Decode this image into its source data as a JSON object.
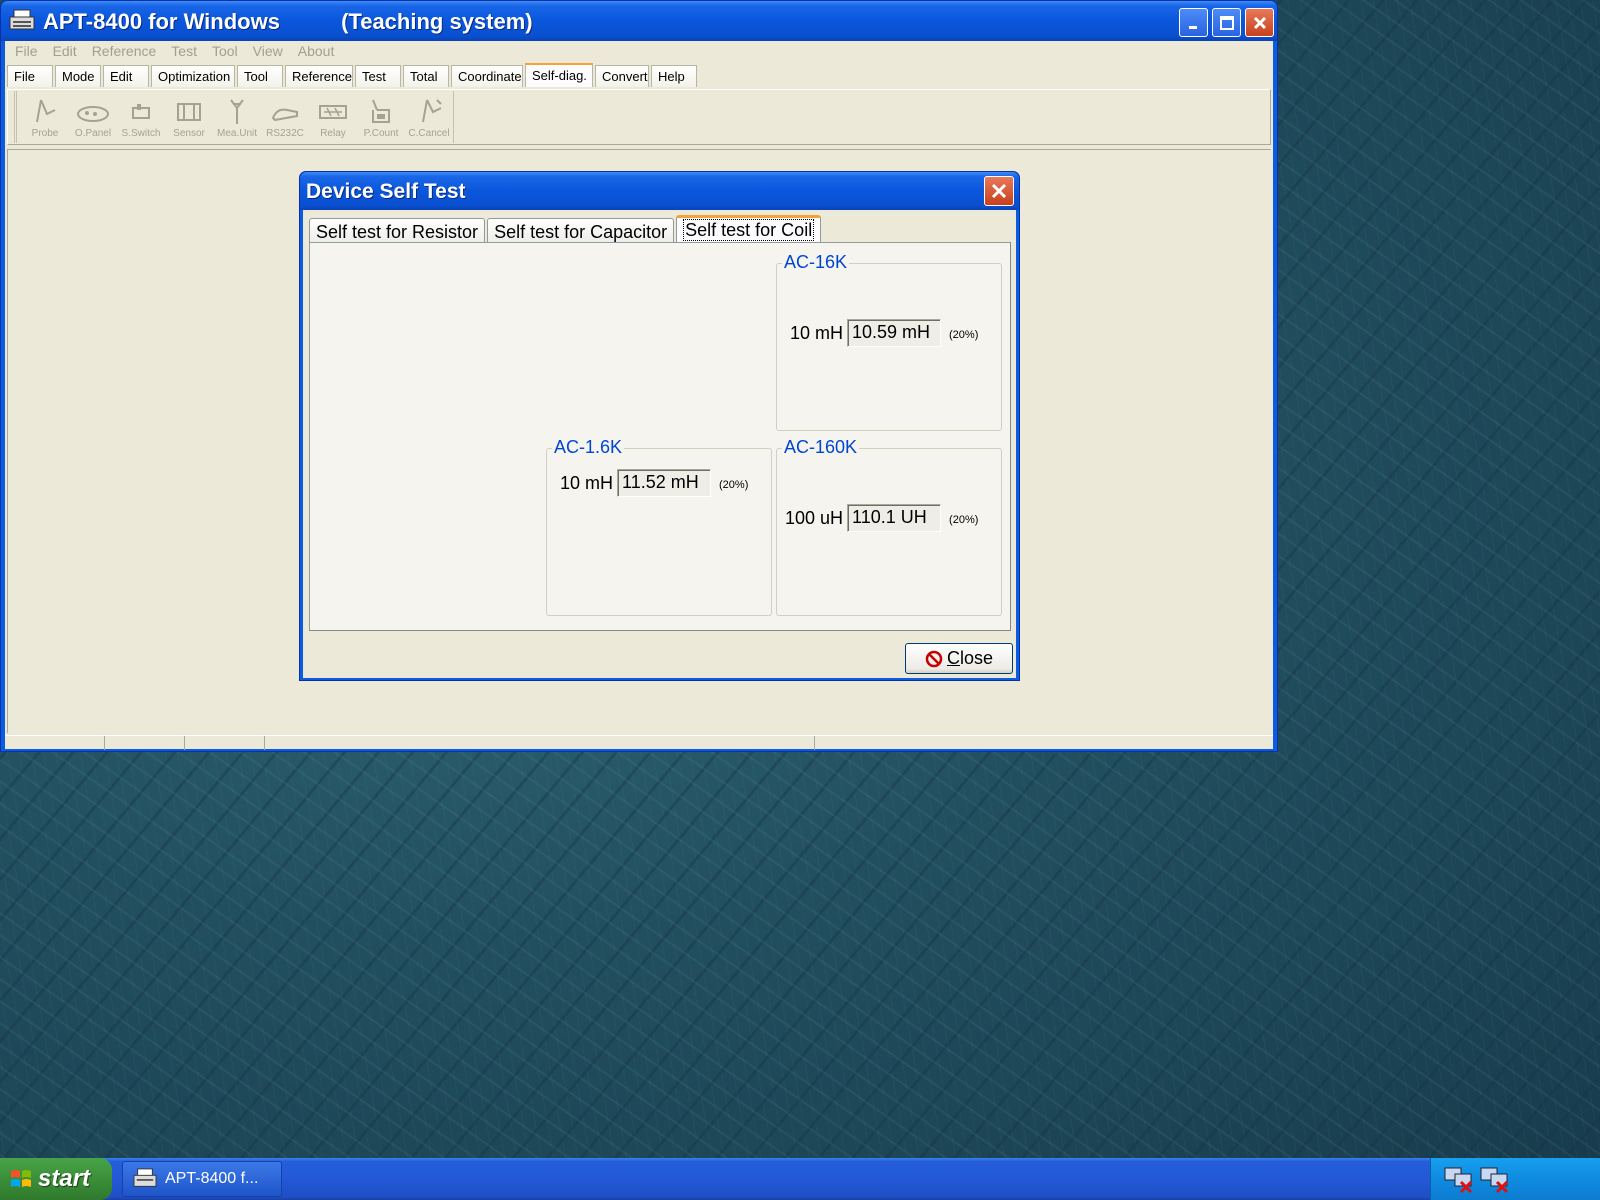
{
  "window": {
    "title": "APT-8400 for Windows          (Teaching system)",
    "menu": [
      "File",
      "Edit",
      "Reference",
      "Test",
      "Tool",
      "View",
      "About"
    ],
    "tabs": [
      "File",
      "Mode",
      "Edit",
      "Optimization",
      "Tool",
      "Reference",
      "Test",
      "Total",
      "Coordinate",
      "Self-diag.",
      "Convert",
      "Help"
    ],
    "active_tab": "Self-diag.",
    "toolbar": [
      "Probe",
      "O.Panel",
      "S.Switch",
      "Sensor",
      "Mea.Unit",
      "RS232C",
      "Relay",
      "P.Count",
      "C.Cancel"
    ]
  },
  "dialog": {
    "title": "Device Self Test",
    "tabs": [
      "Self test for Resistor",
      "Self test for Capacitor",
      "Self test for Coil"
    ],
    "active_tab": "Self test for Coil",
    "groups": {
      "ac16k": {
        "title": "AC-16K",
        "nominal": "10 mH",
        "value": "10.59 mH",
        "tolerance": "(20%)"
      },
      "ac1_6k": {
        "title": "AC-1.6K",
        "nominal": "10 mH",
        "value": "11.52 mH",
        "tolerance": "(20%)"
      },
      "ac160k": {
        "title": "AC-160K",
        "nominal": "100 uH",
        "value": "110.1 UH",
        "tolerance": "(20%)"
      }
    },
    "close_label": "Close",
    "close_underline": "C",
    "close_rest": "lose"
  },
  "taskbar": {
    "start_label": "start",
    "task_label": "APT-8400 f..."
  },
  "colors": {
    "title_blue": "#0a57dc",
    "group_title": "#0046d5",
    "face": "#ece9d8",
    "tab_accent": "#f7a13a"
  }
}
